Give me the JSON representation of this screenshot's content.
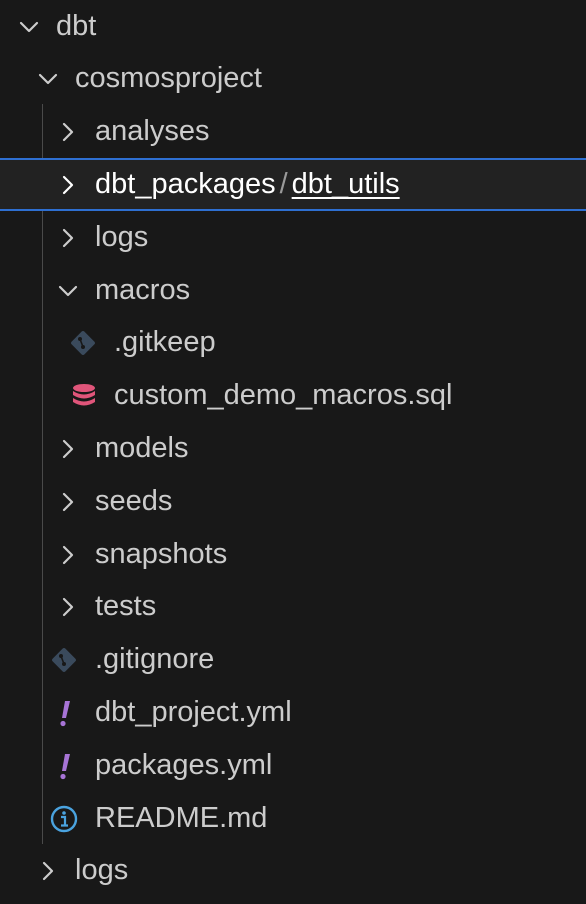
{
  "tree": {
    "root": {
      "label": "dbt",
      "icon": "chevron-down-icon"
    },
    "project": {
      "label": "cosmosproject",
      "icon": "chevron-down-icon"
    },
    "analyses": {
      "label": "analyses",
      "icon": "chevron-right-icon"
    },
    "dbt_packages": {
      "parent_label": "dbt_packages",
      "separator": "/",
      "child_label": "dbt_utils",
      "icon": "chevron-right-icon"
    },
    "logs_inner": {
      "label": "logs",
      "icon": "chevron-right-icon"
    },
    "macros": {
      "label": "macros",
      "icon": "chevron-down-icon",
      "children": [
        {
          "label": ".gitkeep",
          "icon": "git-icon"
        },
        {
          "label": "custom_demo_macros.sql",
          "icon": "database-icon"
        }
      ]
    },
    "models": {
      "label": "models",
      "icon": "chevron-right-icon"
    },
    "seeds": {
      "label": "seeds",
      "icon": "chevron-right-icon"
    },
    "snapshots": {
      "label": "snapshots",
      "icon": "chevron-right-icon"
    },
    "tests": {
      "label": "tests",
      "icon": "chevron-right-icon"
    },
    "files": [
      {
        "label": ".gitignore",
        "icon": "git-icon"
      },
      {
        "label": "dbt_project.yml",
        "icon": "yaml-exclamation-icon"
      },
      {
        "label": "packages.yml",
        "icon": "yaml-exclamation-icon"
      },
      {
        "label": "README.md",
        "icon": "info-icon"
      }
    ],
    "logs_outer": {
      "label": "logs",
      "icon": "chevron-right-icon"
    }
  },
  "colors": {
    "background": "#181818",
    "text": "#cccccc",
    "selected_text": "#ffffff",
    "selection_border": "#2e6fd1",
    "git_icon": "#3a4a5c",
    "database_icon": "#e0557a",
    "yaml_icon": "#a774d6",
    "info_icon": "#4aa3df"
  }
}
